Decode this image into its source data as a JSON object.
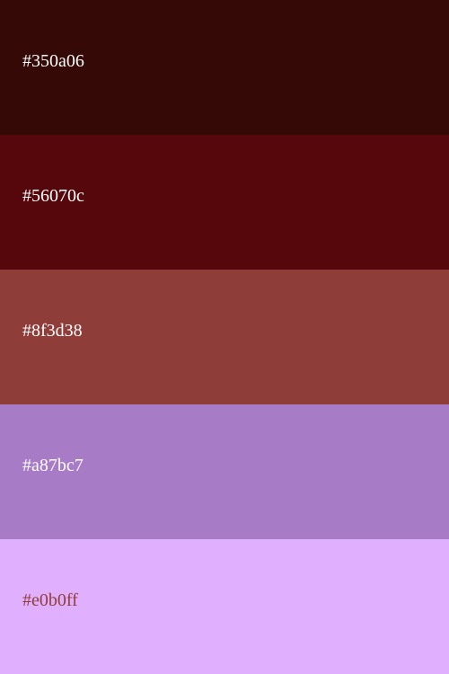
{
  "palette": {
    "swatches": [
      {
        "label": "#350a06",
        "color": "#350a06",
        "text_color": "#ffffff"
      },
      {
        "label": "#56070c",
        "color": "#56070c",
        "text_color": "#ffffff"
      },
      {
        "label": "#8f3d38",
        "color": "#8f3d38",
        "text_color": "#ffffff"
      },
      {
        "label": "#a87bc7",
        "color": "#a87bc7",
        "text_color": "#ffffff"
      },
      {
        "label": "#e0b0ff",
        "color": "#e0b0ff",
        "text_color": "#8f3d38"
      }
    ]
  }
}
